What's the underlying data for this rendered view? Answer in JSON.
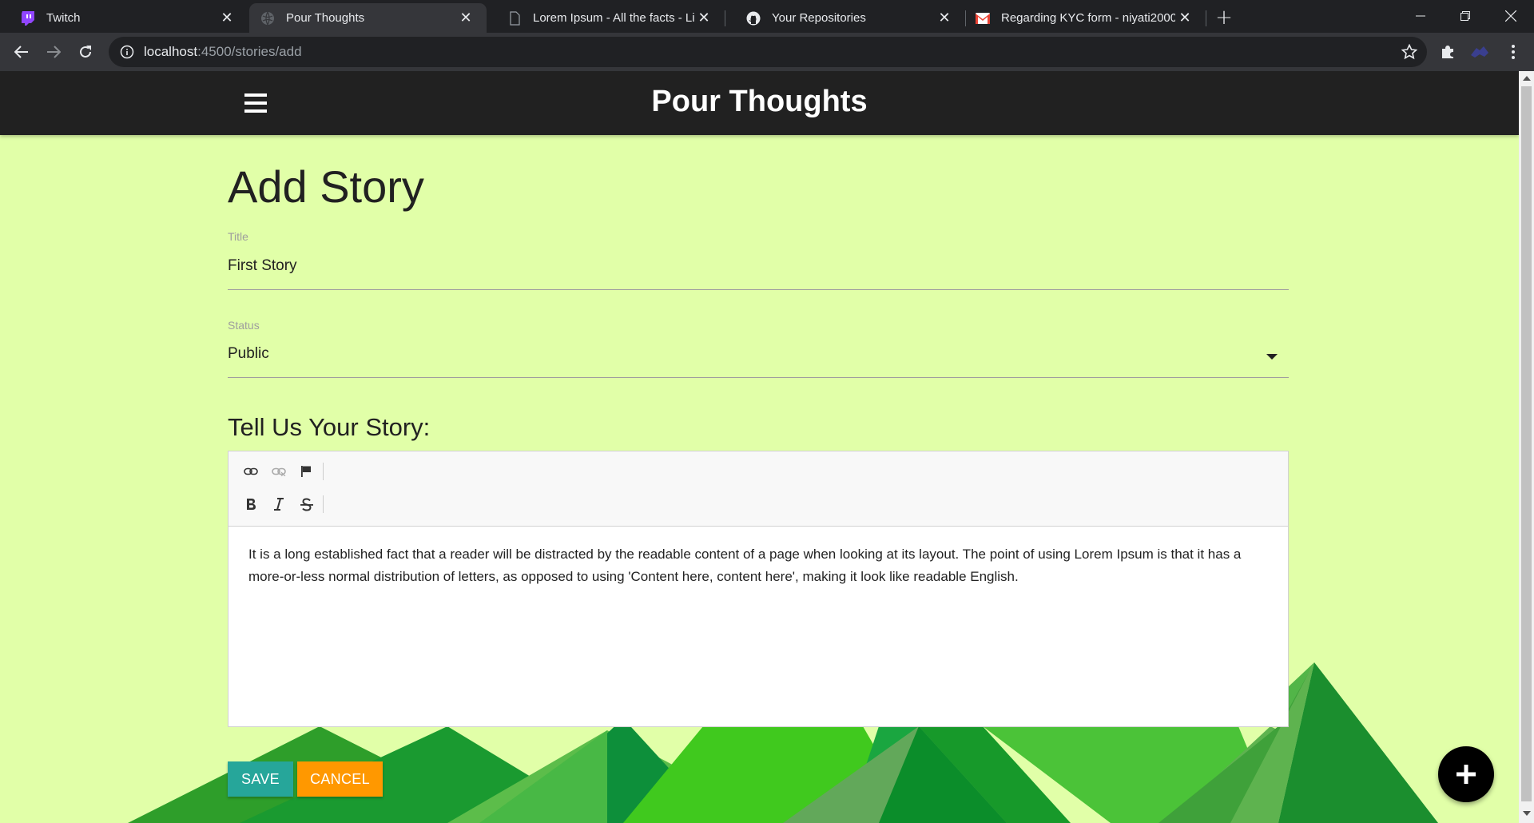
{
  "browser": {
    "tabs": [
      {
        "title": "Twitch",
        "icon": "twitch-icon",
        "active": false
      },
      {
        "title": "Pour Thoughts",
        "icon": "globe-icon",
        "active": true
      },
      {
        "title": "Lorem Ipsum - All the facts - Lips",
        "icon": "page-icon",
        "active": false
      },
      {
        "title": "Your Repositories",
        "icon": "github-icon",
        "active": false
      },
      {
        "title": "Regarding KYC form - niyati2000",
        "icon": "gmail-icon",
        "active": false
      }
    ],
    "url_host": "localhost",
    "url_rest": ":4500/stories/add"
  },
  "app": {
    "brand": "Pour Thoughts"
  },
  "form": {
    "page_title": "Add Story",
    "title_label": "Title",
    "title_value": "First Story",
    "status_label": "Status",
    "status_value": "Public",
    "story_heading": "Tell Us Your Story:",
    "story_body": "It is a long established fact that a reader will be distracted by the readable content of a page when looking at its layout. The point of using Lorem Ipsum is that it has a more-or-less normal distribution of letters, as opposed to using 'Content here, content here', making it look like readable English.",
    "save_label": "SAVE",
    "cancel_label": "CANCEL"
  },
  "colors": {
    "page_bg": "#e1ffa8",
    "navbar_bg": "#212121",
    "save_btn": "#26a69a",
    "cancel_btn": "#ff9800",
    "fab_bg": "#000000"
  }
}
